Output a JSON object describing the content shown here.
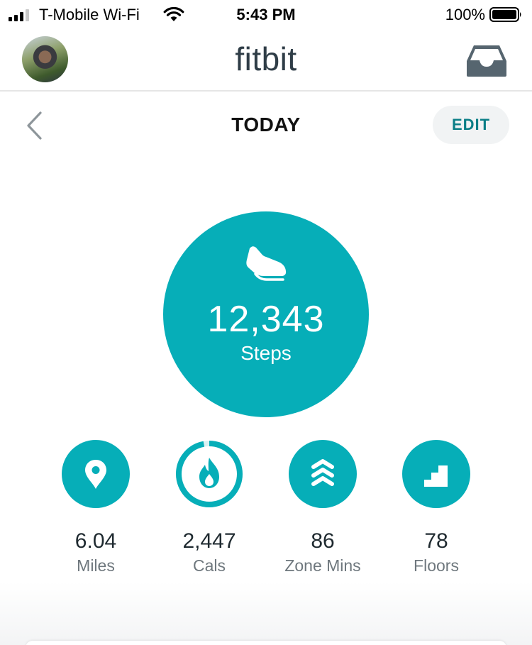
{
  "status_bar": {
    "carrier": "T-Mobile Wi-Fi",
    "time": "5:43 PM",
    "battery": "100%",
    "icons": [
      "signal-icon",
      "wifi-icon",
      "battery-icon"
    ]
  },
  "header": {
    "brand": "fitbit",
    "icons": [
      "avatar",
      "inbox-icon"
    ]
  },
  "date_nav": {
    "title": "TODAY",
    "edit_label": "EDIT",
    "icons": [
      "chevron-left-icon"
    ]
  },
  "steps": {
    "value": "12,343",
    "label": "Steps",
    "icon": "shoe-icon"
  },
  "stats": [
    {
      "value": "6.04",
      "label": "Miles",
      "icon": "location-pin-icon"
    },
    {
      "value": "2,447",
      "label": "Cals",
      "icon": "flame-icon",
      "goal_progress": 0.97
    },
    {
      "value": "86",
      "label": "Zone Mins",
      "icon": "zone-chevrons-icon"
    },
    {
      "value": "78",
      "label": "Floors",
      "icon": "stairs-icon"
    }
  ],
  "colors": {
    "accent": "#06aeb8",
    "edit_text": "#0a7e86",
    "brand_text": "#2f3d47",
    "label_gray": "#6e777d"
  }
}
